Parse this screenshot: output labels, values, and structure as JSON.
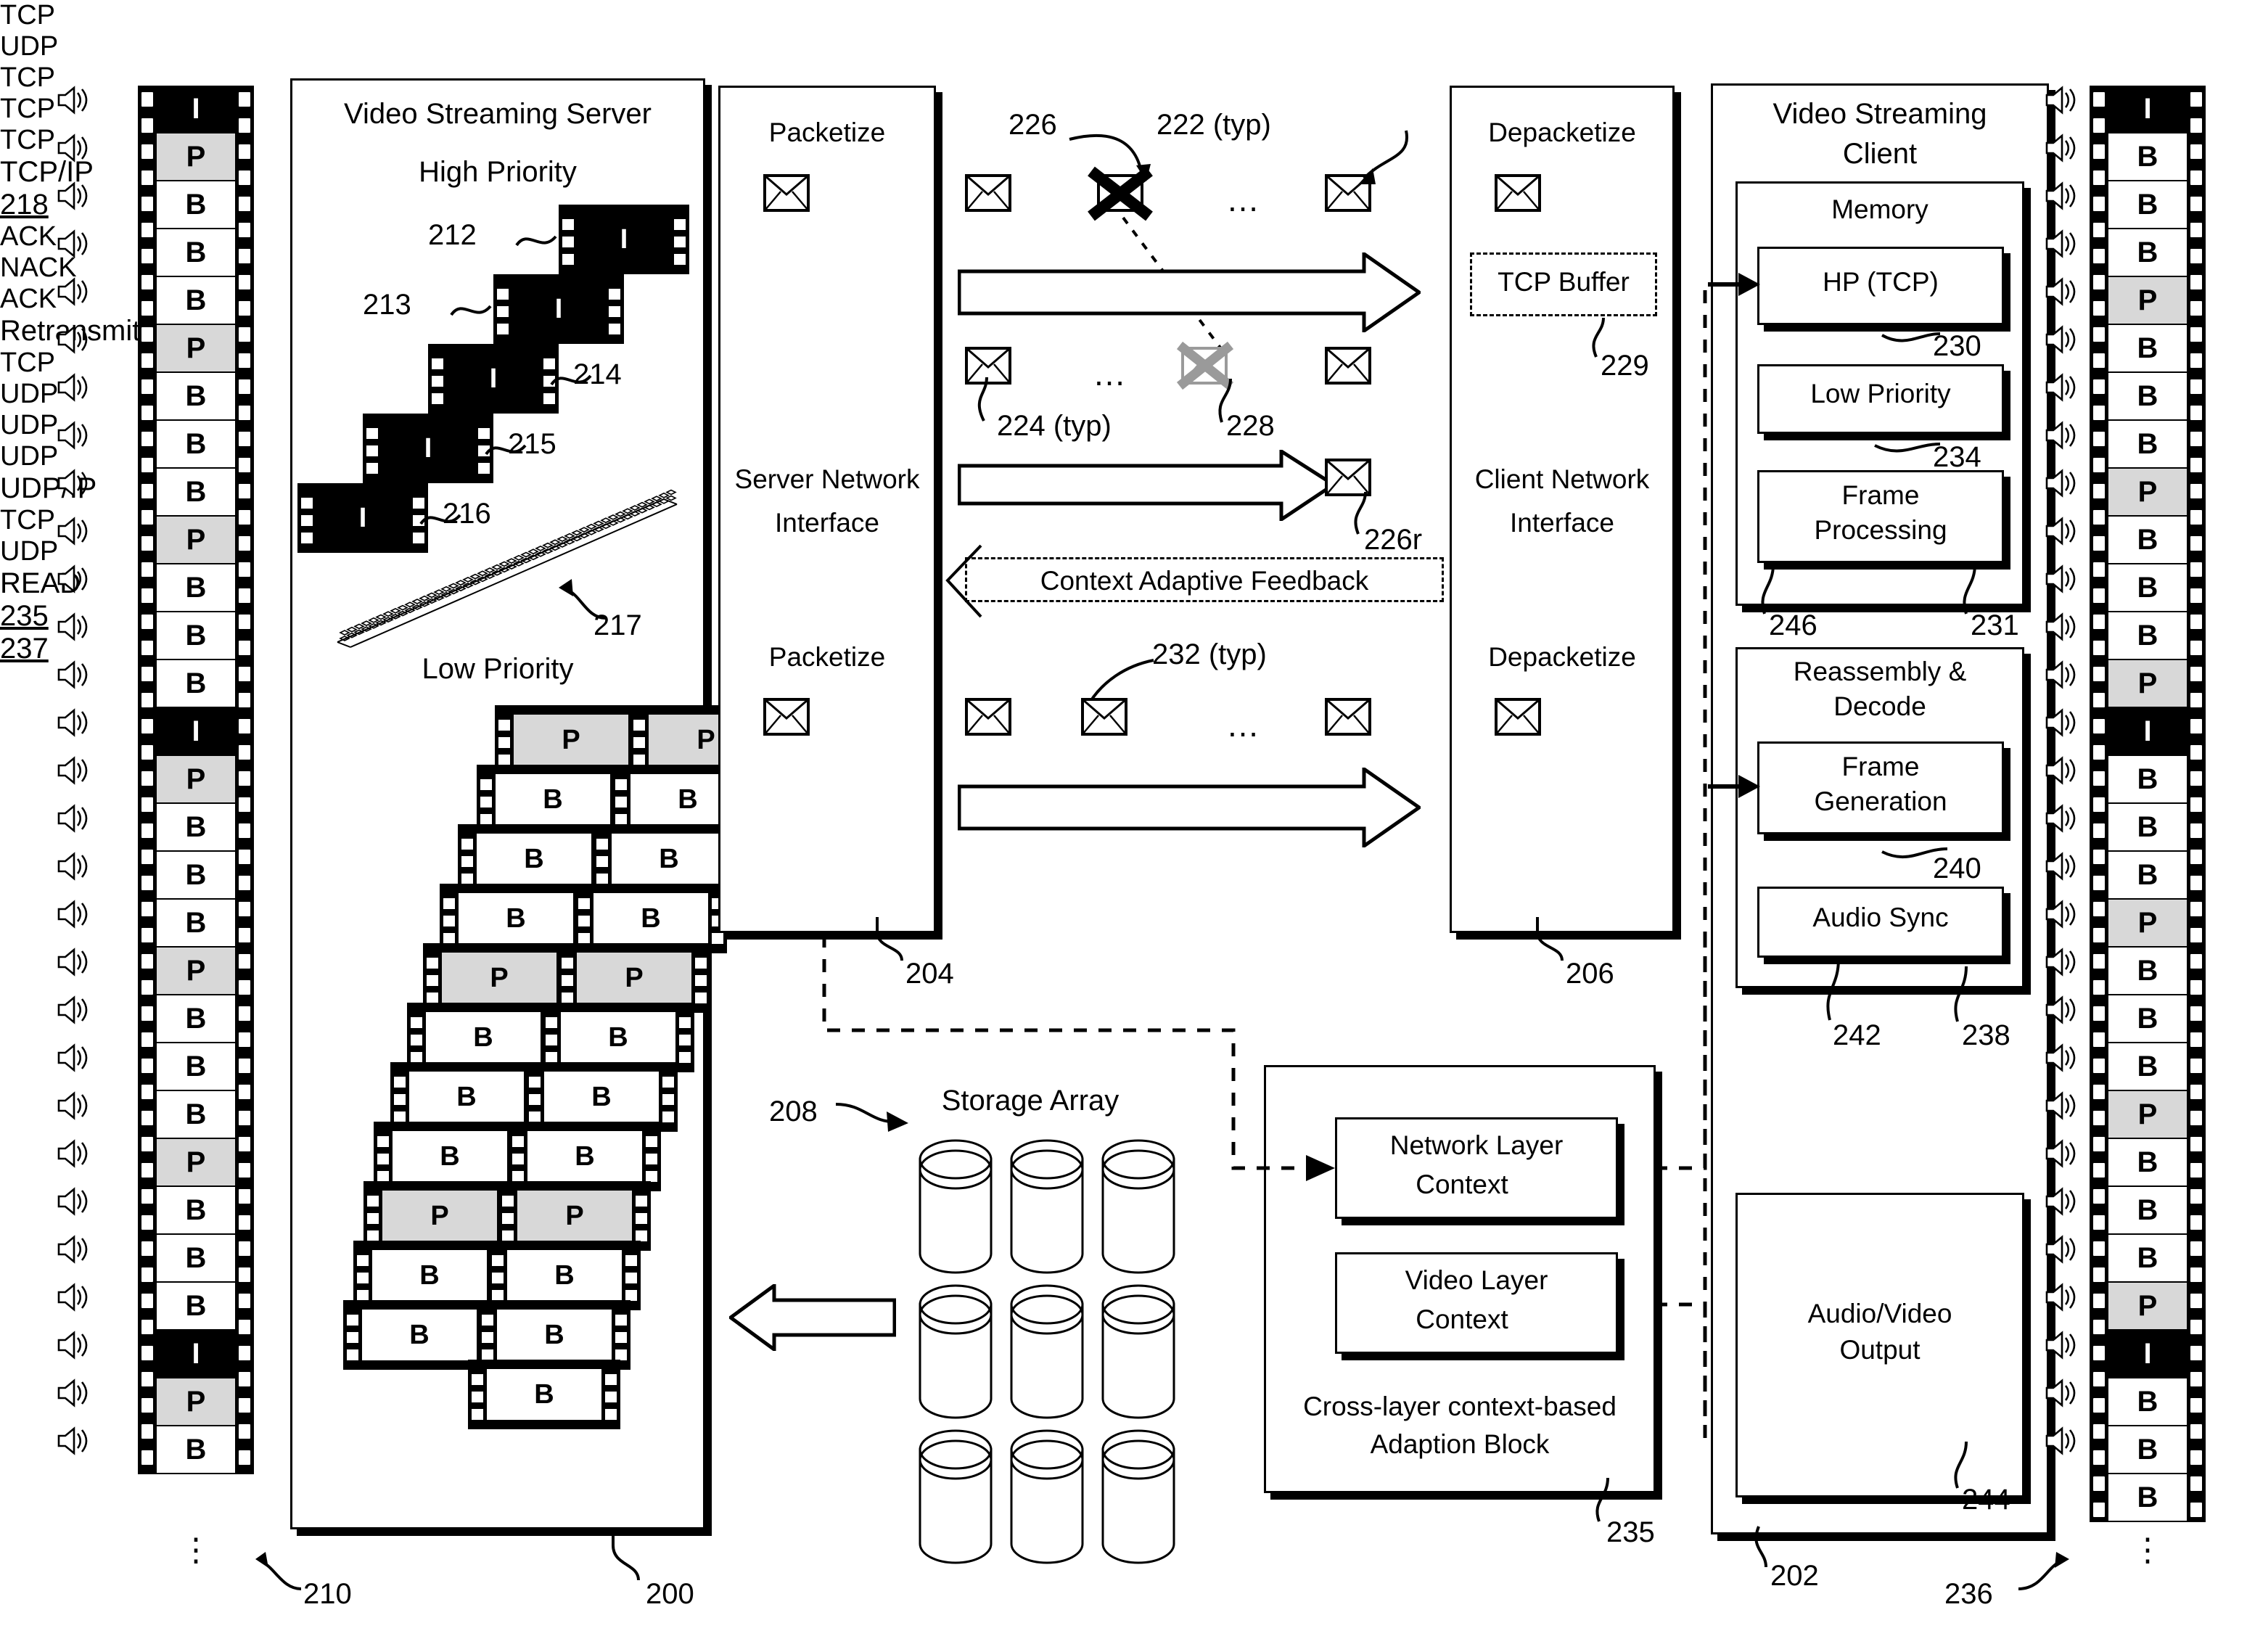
{
  "figure": {
    "server": {
      "title": "Video Streaming Server",
      "high_priority_label": "High Priority",
      "low_priority_label": "Low Priority",
      "ref": "200",
      "iframe_refs": [
        "212",
        "213",
        "214",
        "215",
        "216"
      ],
      "iframe_letter": "I",
      "stack_ref": "217",
      "hp_frames_sequence": [
        "I",
        "I",
        "I",
        "I",
        "I"
      ],
      "lp_strip_left": [
        "P",
        "B",
        "B",
        "B",
        "P",
        "B",
        "B",
        "B",
        "P",
        "B",
        "B"
      ],
      "lp_strip_right": [
        "P",
        "B",
        "B",
        "B",
        "P",
        "B",
        "B",
        "B",
        "P",
        "B",
        "B",
        "B"
      ]
    },
    "left_filmstrip": {
      "ref": "210",
      "frames": [
        "I",
        "P",
        "B",
        "B",
        "B",
        "P",
        "B",
        "B",
        "B",
        "P",
        "B",
        "B",
        "B",
        "I",
        "P",
        "B",
        "B",
        "B",
        "P",
        "B",
        "B",
        "B",
        "P",
        "B",
        "B",
        "B",
        "I",
        "P",
        "B"
      ],
      "ellipsis": "⋮"
    },
    "right_filmstrip": {
      "ref": "236",
      "frames": [
        "I",
        "B",
        "B",
        "B",
        "P",
        "B",
        "B",
        "B",
        "P",
        "B",
        "B",
        "B",
        "P",
        "I",
        "B",
        "B",
        "B",
        "P",
        "B",
        "B",
        "B",
        "P",
        "B",
        "B",
        "B",
        "P",
        "I",
        "B",
        "B",
        "B"
      ],
      "ellipsis": "⋮"
    },
    "server_network_interface": {
      "packetize_top": "Packetize",
      "packetize_bottom": "Packetize",
      "title_line1": "Server Network",
      "title_line2": "Interface",
      "tcp_label": "TCP",
      "udp_label": "UDP",
      "ref": "204"
    },
    "client_network_interface": {
      "depacketize_top": "Depacketize",
      "depacketize_bottom": "Depacketize",
      "title_line1": "Client Network",
      "title_line2": "Interface",
      "tcp_label": "TCP",
      "udp_label": "UDP",
      "tcp_buffer": "TCP Buffer",
      "tcp_buffer_ref": "229",
      "ref": "206"
    },
    "network": {
      "tcp_label": "TCP",
      "udp_label": "UDP",
      "ack_label": "ACK",
      "nack_label": "NACK",
      "ellipsis": "…",
      "tcpip_arrow": "TCP/IP",
      "tcpip_ref": "218",
      "udpip_arrow": "UDP/IP",
      "retransmit_arrow": "Retransmit",
      "feedback_label": "Context Adaptive Feedback",
      "ref_226": "226",
      "ref_222": "222 (typ)",
      "ref_224": "224 (typ)",
      "ref_228": "228",
      "ref_226r": "226r",
      "ref_232": "232 (typ)"
    },
    "client": {
      "title_line1": "Video Streaming",
      "title_line2": "Client",
      "memory_label": "Memory",
      "hp_tcp": "HP (TCP)",
      "hp_tcp_ref": "230",
      "low_priority": "Low Priority",
      "low_priority_ref": "234",
      "frame_processing_line1": "Frame",
      "frame_processing_line2": "Processing",
      "frame_processing_ref": "246",
      "memory_ref": "231",
      "reassembly_line1": "Reassembly &",
      "reassembly_line2": "Decode",
      "frame_generation_line1": "Frame",
      "frame_generation_line2": "Generation",
      "frame_generation_ref": "240",
      "audio_sync": "Audio Sync",
      "audio_sync_ref": "242",
      "reassembly_ref": "238",
      "av_output_line1": "Audio/Video",
      "av_output_line2": "Output",
      "av_output_ref": "244",
      "ref": "202"
    },
    "storage": {
      "title": "Storage Array",
      "ref": "208",
      "read_label": "READ",
      "rows": 3,
      "cols": 3
    },
    "adaptation": {
      "network_layer_line1": "Network Layer",
      "network_layer_line2": "Context",
      "network_layer_ref": "235",
      "video_layer_line1": "Video Layer",
      "video_layer_line2": "Context",
      "video_layer_ref": "237",
      "block_line1": "Cross-layer context-based",
      "block_line2": "Adaption Block",
      "block_ref": "235"
    }
  }
}
